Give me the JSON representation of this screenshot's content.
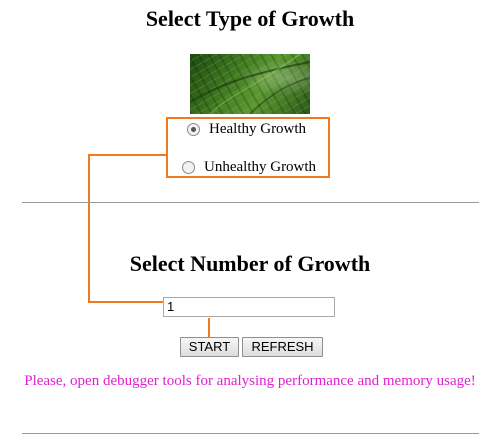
{
  "growth_type": {
    "title": "Select Type of Growth",
    "options": [
      {
        "label": "Healthy Growth",
        "checked": true
      },
      {
        "label": "Unhealthy Growth",
        "checked": false
      }
    ]
  },
  "growth_number": {
    "title": "Select Number of Growth",
    "input_value": "1"
  },
  "buttons": {
    "start_label": "START",
    "refresh_label": "REFRESH"
  },
  "notice": {
    "text": "Please, open debugger tools for analysing performance and memory usage!",
    "color": "#e020d0"
  },
  "highlight_color": "#f07a20"
}
